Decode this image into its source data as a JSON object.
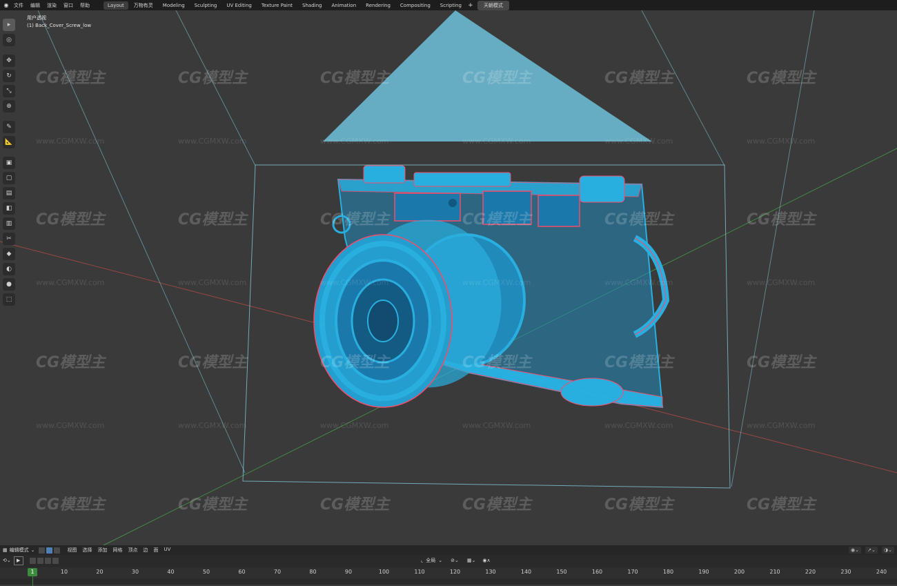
{
  "topbar": {
    "menus": [
      "文件",
      "编辑",
      "渲染",
      "窗口",
      "帮助"
    ],
    "workspaces": [
      "Layout",
      "万物有灵",
      "Modeling",
      "Sculpting",
      "UV Editing",
      "Texture Paint",
      "Shading",
      "Animation",
      "Rendering",
      "Compositing",
      "Scripting"
    ],
    "active_workspace": "Layout",
    "add_symbol": "+",
    "mode_label": "天朝模式"
  },
  "viewport": {
    "view_name": "用户透视",
    "object_name": "(1) Back_Cover_Screw_low",
    "watermark_text": "CG模型主",
    "watermark_url": "www.CGMXW.com"
  },
  "tools": [
    "select-box",
    "cursor",
    "move",
    "rotate",
    "scale",
    "transform",
    "annotate",
    "measure",
    "add-cube",
    "extrude",
    "inset",
    "bevel",
    "loop-cut",
    "knife",
    "poly-build",
    "spin",
    "smooth",
    "edge-slide",
    "shrink-fatten",
    "shear",
    "rip"
  ],
  "header2": {
    "mode": "编辑模式",
    "menus": [
      "视图",
      "选择",
      "添加",
      "网格",
      "顶点",
      "边",
      "面",
      "UV"
    ]
  },
  "timeline": {
    "pivot_label": "全局",
    "current_frame": "1",
    "ticks": [
      "10",
      "20",
      "30",
      "40",
      "50",
      "60",
      "70",
      "80",
      "90",
      "100",
      "110",
      "120",
      "130",
      "140",
      "150",
      "160",
      "170",
      "180",
      "190",
      "200",
      "210",
      "220",
      "230",
      "240"
    ]
  },
  "colors": {
    "wire": "#29b6e8",
    "wire_edge": "#ff4d6d",
    "camera_fill": "#6bb9d1",
    "axis_x": "#b84a4a",
    "axis_y": "#4aa84a",
    "bbox": "#7fc8d8",
    "accent": "#4f7fb5"
  }
}
